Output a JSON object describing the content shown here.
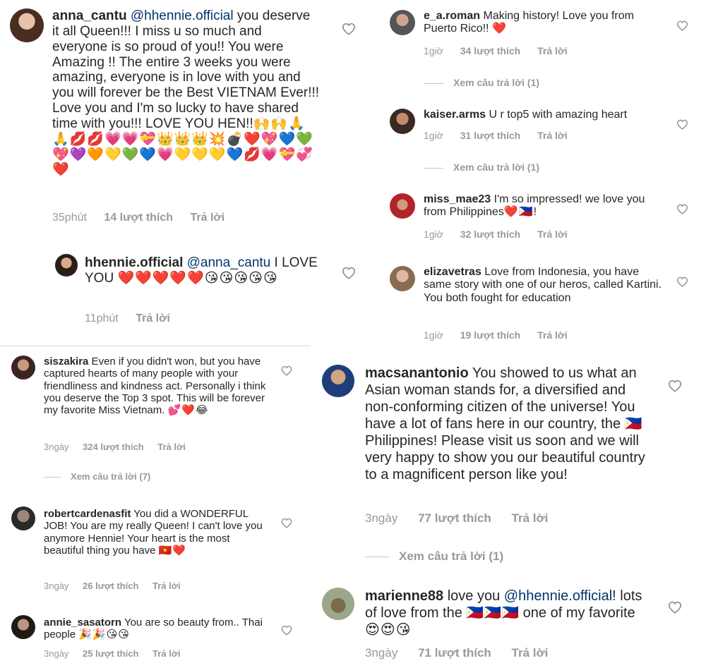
{
  "colors": {
    "text": "#262626",
    "meta": "#999999",
    "mention": "#003569",
    "heart": "#ed4956",
    "divider": "#dbdbdb"
  },
  "c1": {
    "user": "anna_cantu",
    "mention": "@hhennie.official",
    "text": " you deserve it all Queen!!! I miss u so much and everyone is so proud of you!! You were Amazing !! The entire 3 weeks you were amazing, everyone is in love with you and you will forever be the Best VIETNAM Ever!!! Love you and I'm so lucky to have shared time with you!!! LOVE YOU HEN!!",
    "emoji": "🙌🙌🙏🙏💋💋💗💗💝👑👑👑💥💣❤️💖💙💚💖💜🧡💛💚💙💗💛💛💛💙💋💗💝💞❤️",
    "time": "35phút",
    "likes": "14 lượt thích",
    "reply": "Trả lời",
    "icon": "heart-outline-icon"
  },
  "c1r": {
    "user": "hhennie.official",
    "mention": "@anna_cantu",
    "text": " I LOVE YOU ",
    "emoji": "❤️❤️❤️❤️❤️😘😘😘😘😘",
    "time": "11phút",
    "reply": "Trả lời",
    "icon": "heart-outline-icon"
  },
  "c2": {
    "user": "siszakira",
    "text": " Even if you didn't won, but you have captured hearts of many people with your friendliness and kindness act. Personally i think you deserve the Top 3 spot. This will be forever my favorite Miss Vietnam. ",
    "emoji": "💕❤️😂",
    "time": "3ngày",
    "likes": "324 lượt thích",
    "reply": "Trả lời",
    "view": "Xem câu trả lời (7)",
    "icon": "heart-outline-icon"
  },
  "c3": {
    "user": "robertcardenasfit",
    "text": " You did a WONDERFUL JOB! You are my really Queen! I can't love you anymore Hennie! Your heart is the most beautiful thing you have ",
    "emoji": "🇻🇳❤️",
    "time": "3ngày",
    "likes": "26 lượt thích",
    "reply": "Trả lời",
    "icon": "heart-outline-icon"
  },
  "c4": {
    "user": "annie_sasatorn",
    "text": " You are so beauty from.. Thai people ",
    "emoji": "🎉🎉😘😘",
    "time": "3ngày",
    "likes": "25 lượt thích",
    "reply": "Trả lời",
    "icon": "heart-outline-icon"
  },
  "c5": {
    "user": "e_a.roman",
    "text": " Making history! Love you from Puerto Rico!! ",
    "emoji": "❤️",
    "time": "1giờ",
    "likes": "34 lượt thích",
    "reply": "Trả lời",
    "view": "Xem câu trả lời (1)",
    "icon": "heart-outline-icon"
  },
  "c6": {
    "user": "kaiser.arms",
    "text": " U r top5 with amazing heart",
    "time": "1giờ",
    "likes": "31 lượt thích",
    "reply": "Trả lời",
    "view": "Xem câu trả lời (1)",
    "icon": "heart-outline-icon"
  },
  "c7": {
    "user": "miss_mae23",
    "text": " I'm so impressed! we love you from Philippines",
    "emoji": "❤️🇵🇭",
    "tail": "!",
    "time": "1giờ",
    "likes": "32 lượt thích",
    "reply": "Trả lời",
    "icon": "heart-outline-icon"
  },
  "c8": {
    "user": "elizavetras",
    "text": " Love from Indonesia, you have same story with one of our heros, called Kartini.  You both fought for education",
    "time": "1giờ",
    "likes": "19 lượt thích",
    "reply": "Trả lời",
    "icon": "heart-outline-icon"
  },
  "c9": {
    "user": "macsanantonio",
    "text": " You showed to us what an Asian woman stands for, a diversified and non-conforming citizen of the universe! You have a lot of fans here in our country, the ",
    "flag": "🇵🇭",
    "text2": " Philippines! Please visit us soon and we will very happy to show you our beautiful country to a magnificent person like you!",
    "time": "3ngày",
    "likes": "77 lượt thích",
    "reply": "Trả lời",
    "view": "Xem câu trả lời (1)",
    "icon": "heart-outline-icon"
  },
  "c10": {
    "user": "marienne88",
    "pre": " love you ",
    "mention": "@hhennie.official",
    "text": "! lots of love from the ",
    "flags": "🇵🇭🇵🇭🇵🇭",
    "text2": " one of my favorite ",
    "emoji": "😍😍😘",
    "time": "3ngày",
    "likes": "71 lượt thích",
    "reply": "Trả lời",
    "icon": "heart-outline-icon"
  }
}
